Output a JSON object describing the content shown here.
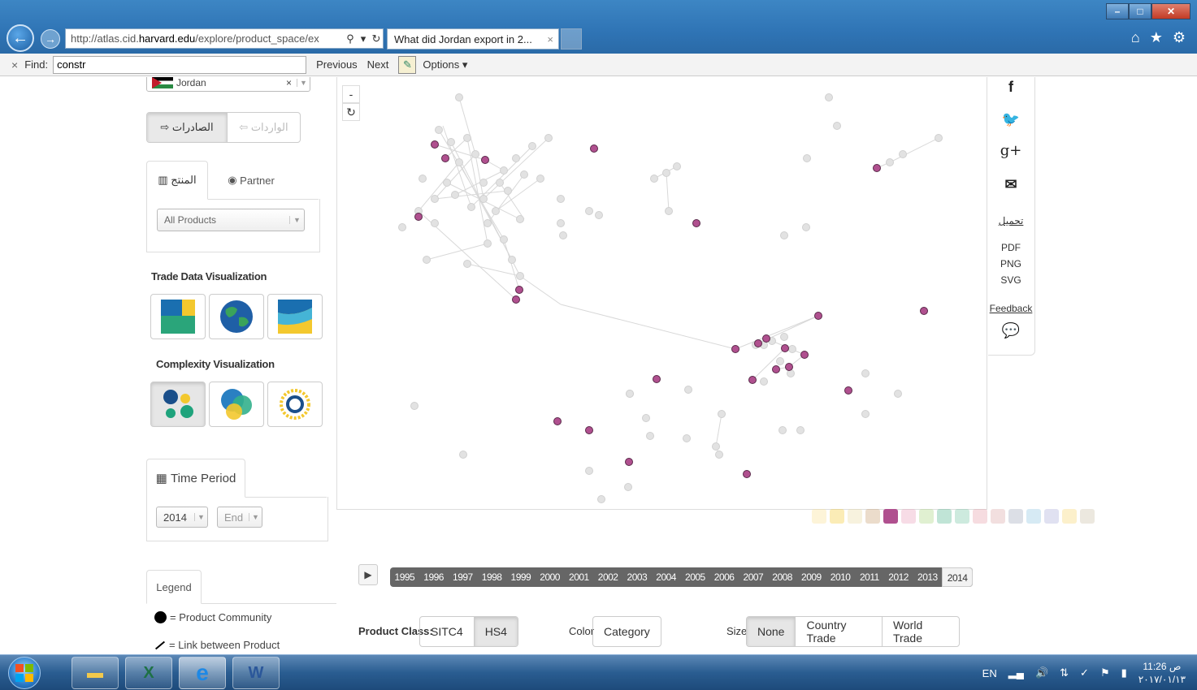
{
  "browser": {
    "url_prefix": "http://atlas.cid.",
    "url_host": "harvard.edu",
    "url_suffix": "/explore/product_space/ex",
    "tab_title": "What did Jordan export in 2...",
    "tab_close": "×"
  },
  "findbar": {
    "close": "×",
    "label": "Find:",
    "query": "constr",
    "previous": "Previous",
    "next": "Next",
    "options": "Options ▾"
  },
  "sidebar": {
    "country": "Jordan",
    "country_clear": "×",
    "flow_exports": "الصادرات",
    "flow_imports": "الواردات",
    "tab_product": "المنتج",
    "tab_partner": "Partner",
    "product_select": "All Products",
    "trade_title": "Trade Data Visualization",
    "complexity_title": "Complexity Visualization",
    "time_tab": "Time Period",
    "start_year": "2014",
    "end_year": "End",
    "legend_tab": "Legend",
    "legend_community": "= Product Community",
    "legend_link": "= Link between Product"
  },
  "viz": {
    "zoom_out": "-",
    "reset": "↻",
    "node_color_highlight": "#b0508f",
    "node_color_default": "#e2e2e2"
  },
  "timeline": {
    "play": "▶",
    "years": [
      "1995",
      "1996",
      "1997",
      "1998",
      "1999",
      "2000",
      "2001",
      "2002",
      "2003",
      "2004",
      "2005",
      "2006",
      "2007",
      "2008",
      "2009",
      "2010",
      "2011",
      "2012",
      "2013",
      "2014"
    ],
    "selected": "2014"
  },
  "controls": {
    "product_class_label": "Product Class:",
    "product_class": [
      "SITC4",
      "HS4"
    ],
    "product_class_selected": "HS4",
    "color_label": "Color",
    "color_value": "Category",
    "size_label": "Size",
    "size_options": [
      "None",
      "Country Trade",
      "World Trade"
    ],
    "size_selected": "None"
  },
  "social": {
    "facebook": "f",
    "google": "g+",
    "download_label": "تحميل",
    "pdf": "PDF",
    "png": "PNG",
    "svg": "SVG",
    "feedback": "Feedback"
  },
  "taskbar": {
    "lang": "EN",
    "time": "11:26 ص",
    "date": "٢٠١٧/٠١/١٣"
  }
}
